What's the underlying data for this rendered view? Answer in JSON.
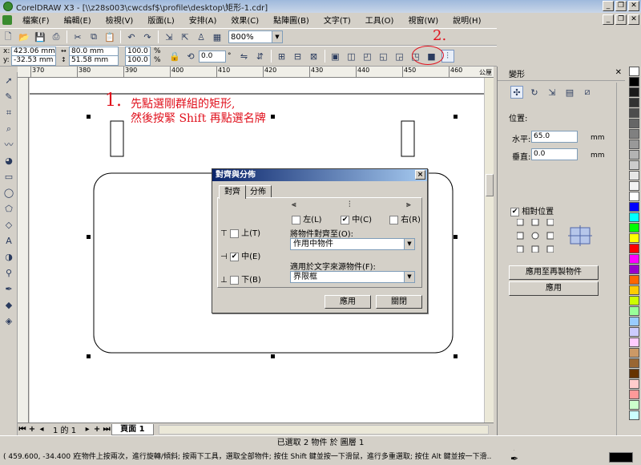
{
  "window": {
    "title": "CorelDRAW X3 - [\\\\z28s003\\cwcdsf$\\profile\\desktop\\矩形-1.cdr]"
  },
  "menu": [
    "檔案(F)",
    "編輯(E)",
    "檢視(V)",
    "版面(L)",
    "安排(A)",
    "效果(C)",
    "點陣圖(B)",
    "文字(T)",
    "工具(O)",
    "視窗(W)",
    "說明(H)"
  ],
  "toolbar": {
    "zoom": "800%"
  },
  "property_bar": {
    "x": "423.06 mm",
    "y": "-32.53 mm",
    "width": "80.0 mm",
    "height": "51.58 mm",
    "scale_x": "100.0",
    "scale_y": "100.0",
    "percent": "%",
    "rotation": "0.0",
    "degree": "°"
  },
  "ruler": {
    "labels": [
      "370",
      "380",
      "390",
      "400",
      "410",
      "420",
      "430",
      "440",
      "450",
      "460"
    ],
    "unit": "公厘"
  },
  "annotations": {
    "step1_number": "1.",
    "step1_line1": "先點選剛群組的矩形,",
    "step1_line2": "然後按緊 Shift 再點選名牌",
    "step2_number": "2."
  },
  "dialog": {
    "title": "對齊與分佈",
    "close": "×",
    "tabs": [
      "對齊",
      "分佈"
    ],
    "left": "左(L)",
    "center_h": "中(C)",
    "right": "右(R)",
    "top": "上(T)",
    "center_v": "中(E)",
    "bottom": "下(B)",
    "align_to_label": "將物件對齊至(O):",
    "align_to_value": "作用中物件",
    "text_source_label": "適用於文字來源物件(F):",
    "text_source_value": "界限框",
    "apply": "應用",
    "close_btn": "關閉"
  },
  "docker": {
    "title": "變形",
    "position_label": "位置:",
    "h_label": "水平:",
    "h_value": "65.0",
    "h_unit": "mm",
    "v_label": "垂直:",
    "v_value": "0.0",
    "v_unit": "mm",
    "relative_label": "相對位置",
    "apply_dup": "應用至再製物件",
    "apply": "應用"
  },
  "pagebar": {
    "page_info": "1 的 1",
    "page_tab": "頁面 1"
  },
  "status": {
    "selection": "已選取 2 物件 於 圖層 1",
    "coords": "( 459.600, -34.400 )",
    "hint": "在物件上按兩次，進行旋轉/傾斜; 按兩下工具，選取全部物件; 按住 Shift 鍵並按一下滑鼠，進行多重選取; 按住 Alt 鍵並按一下滑..."
  },
  "palette_colors": [
    "#ffffff",
    "#000000",
    "#1a1a1a",
    "#333333",
    "#4d4d4d",
    "#666666",
    "#808080",
    "#999999",
    "#b3b3b3",
    "#cccccc",
    "#e6e6e6",
    "#f2f2f2",
    "#ffffff",
    "#0000ff",
    "#00ffff",
    "#00ff00",
    "#ffff00",
    "#ff0000",
    "#ff00ff",
    "#9900cc",
    "#ff6600",
    "#ffcc00",
    "#ccff00",
    "#99ff99",
    "#99ccff",
    "#ccccff",
    "#ffccff",
    "#cc9966",
    "#996633",
    "#663300",
    "#ffcccc",
    "#ff9999",
    "#ccffcc",
    "#ccffff"
  ]
}
